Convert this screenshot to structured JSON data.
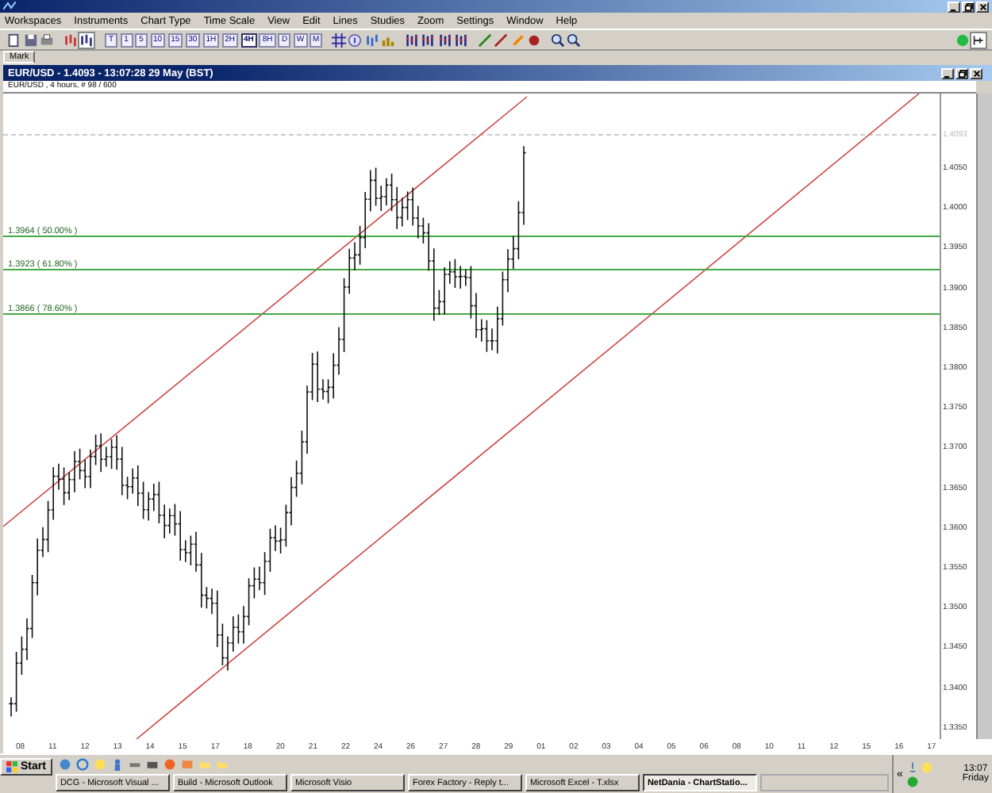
{
  "menu": [
    "Workspaces",
    "Instruments",
    "Chart Type",
    "Time Scale",
    "View",
    "Edit",
    "Lines",
    "Studies",
    "Zoom",
    "Settings",
    "Window",
    "Help"
  ],
  "time_scales": [
    {
      "label": "T",
      "selected": false
    },
    {
      "label": "1",
      "selected": false
    },
    {
      "label": "5",
      "selected": false
    },
    {
      "label": "10",
      "selected": false
    },
    {
      "label": "15",
      "selected": false
    },
    {
      "label": "30",
      "selected": false
    },
    {
      "label": "1H",
      "selected": false
    },
    {
      "label": "2H",
      "selected": false
    },
    {
      "label": "4H",
      "selected": true
    },
    {
      "label": "8H",
      "selected": false
    },
    {
      "label": "D",
      "selected": false
    },
    {
      "label": "W",
      "selected": false
    },
    {
      "label": "M",
      "selected": false
    }
  ],
  "tab": {
    "label": "Mark"
  },
  "chart_window": {
    "title": "EUR/USD - 1.4093 - 13:07:28  29 May (BST)",
    "subtitle": "EUR/USD , 4 hours, # 98 / 600",
    "current_price": "1.4093",
    "price_axis": [
      "1.4050",
      "1.4000",
      "1.3950",
      "1.3900",
      "1.3850",
      "1.3800",
      "1.3750",
      "1.3700",
      "1.3650",
      "1.3600",
      "1.3550",
      "1.3500",
      "1.3450",
      "1.3400",
      "1.3350"
    ],
    "fib_levels": [
      {
        "label": "1.3964 ( 50.00% )"
      },
      {
        "label": "1.3923 ( 61.80% )"
      },
      {
        "label": "1.3866 ( 78.60% )"
      }
    ],
    "date_axis": [
      "08",
      "11",
      "12",
      "13",
      "14",
      "15",
      "17",
      "18",
      "20",
      "21",
      "22",
      "24",
      "26",
      "27",
      "28",
      "29",
      "01",
      "02",
      "03",
      "04",
      "05",
      "06",
      "08",
      "10",
      "11",
      "12",
      "15",
      "16",
      "17"
    ]
  },
  "taskbar": {
    "start": "Start",
    "tasks": [
      {
        "label": "DCG - Microsoft Visual ...",
        "selected": false
      },
      {
        "label": "Build - Microsoft Outlook",
        "selected": false
      },
      {
        "label": "Microsoft Visio",
        "selected": false
      },
      {
        "label": "Forex Factory - Reply t...",
        "selected": false
      },
      {
        "label": "Microsoft Excel - T.xlsx",
        "selected": false
      },
      {
        "label": "NetDania - ChartStatio...",
        "selected": true
      }
    ],
    "tray_toggle": "«",
    "time": "13:07",
    "day": "Friday"
  }
}
